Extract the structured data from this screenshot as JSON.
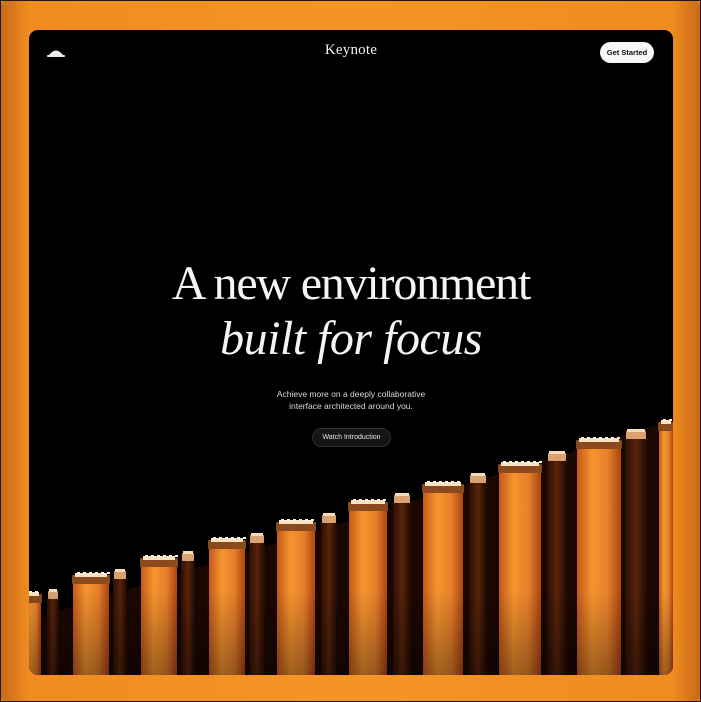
{
  "nav": {
    "brand": "Keynote",
    "logo_icon": "dome-icon",
    "cta_label": "Get Started"
  },
  "hero": {
    "title_line1": "A new environment",
    "title_line2": "built for focus",
    "subtitle_line1": "Achieve more on a deeply collaborative",
    "subtitle_line2": "interface architected around you.",
    "button_label": "Watch Introduction"
  },
  "theme": {
    "frame_color": "#f39020",
    "background": "#000000",
    "column_light": "#f08a2a",
    "column_dark": "#3a1606"
  }
}
